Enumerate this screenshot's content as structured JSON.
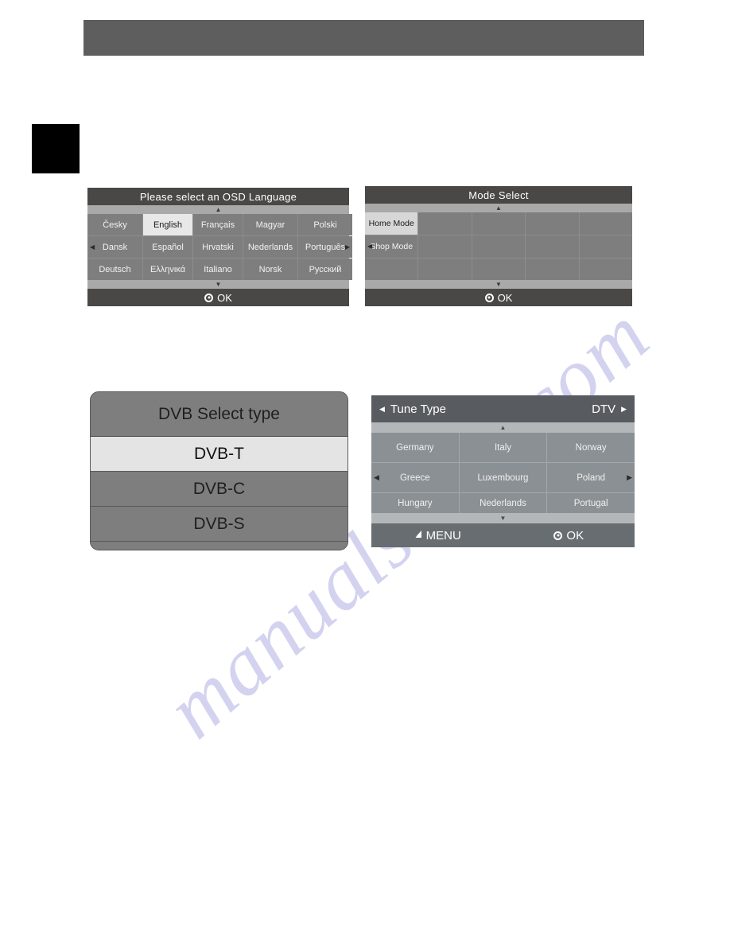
{
  "page": {
    "watermark": "manualshive.com",
    "header_bar_color": "#5e5e5e",
    "marker_color": "#000000"
  },
  "language_panel": {
    "title": "Please select an OSD Language",
    "scroll_up": "▲",
    "scroll_down": "▼",
    "left_arrow": "◀",
    "right_arrow": "▶",
    "selected": "English",
    "rows": [
      [
        {
          "label": "Česky",
          "selected": false,
          "arrow": ""
        },
        {
          "label": "English",
          "selected": true,
          "arrow": ""
        },
        {
          "label": "Français",
          "selected": false,
          "arrow": ""
        },
        {
          "label": "Magyar",
          "selected": false,
          "arrow": ""
        },
        {
          "label": "Polski",
          "selected": false,
          "arrow": ""
        }
      ],
      [
        {
          "label": "Dansk",
          "selected": false,
          "arrow": "left"
        },
        {
          "label": "Español",
          "selected": false,
          "arrow": ""
        },
        {
          "label": "Hrvatski",
          "selected": false,
          "arrow": ""
        },
        {
          "label": "Nederlands",
          "selected": false,
          "arrow": ""
        },
        {
          "label": "Português",
          "selected": false,
          "arrow": "right"
        }
      ],
      [
        {
          "label": "Deutsch",
          "selected": false,
          "arrow": ""
        },
        {
          "label": "Ελληνικά",
          "selected": false,
          "arrow": ""
        },
        {
          "label": "Italiano",
          "selected": false,
          "arrow": ""
        },
        {
          "label": "Norsk",
          "selected": false,
          "arrow": ""
        },
        {
          "label": "Русский",
          "selected": false,
          "arrow": ""
        }
      ]
    ],
    "footer": "OK",
    "footer_icon": "ok-circle-icon"
  },
  "mode_panel": {
    "title": "Mode Select",
    "scroll_up": "▲",
    "scroll_down": "▼",
    "left_arrow": "◀",
    "selected": "Home Mode",
    "rows": [
      [
        {
          "label": "Home Mode",
          "selected": true,
          "arrow": ""
        },
        {
          "label": "",
          "selected": false,
          "arrow": ""
        },
        {
          "label": "",
          "selected": false,
          "arrow": ""
        },
        {
          "label": "",
          "selected": false,
          "arrow": ""
        },
        {
          "label": "",
          "selected": false,
          "arrow": ""
        }
      ],
      [
        {
          "label": "Shop Mode",
          "selected": false,
          "arrow": "left"
        },
        {
          "label": "",
          "selected": false,
          "arrow": ""
        },
        {
          "label": "",
          "selected": false,
          "arrow": ""
        },
        {
          "label": "",
          "selected": false,
          "arrow": ""
        },
        {
          "label": "",
          "selected": false,
          "arrow": ""
        }
      ],
      [
        {
          "label": "",
          "selected": false,
          "arrow": ""
        },
        {
          "label": "",
          "selected": false,
          "arrow": ""
        },
        {
          "label": "",
          "selected": false,
          "arrow": ""
        },
        {
          "label": "",
          "selected": false,
          "arrow": ""
        },
        {
          "label": "",
          "selected": false,
          "arrow": ""
        }
      ]
    ],
    "footer": "OK",
    "footer_icon": "ok-circle-icon"
  },
  "dvb_panel": {
    "title": "DVB Select type",
    "selected": "DVB-T",
    "options": [
      {
        "label": "DVB-T",
        "selected": true
      },
      {
        "label": "DVB-C",
        "selected": false
      },
      {
        "label": "DVB-S",
        "selected": false
      }
    ]
  },
  "tune_panel": {
    "header_left_arrow": "◀",
    "header_title": "Tune Type",
    "header_value": "DTV",
    "header_right_arrow": "▶",
    "scroll_up": "▲",
    "scroll_down": "▼",
    "left_arrow": "◀",
    "right_arrow": "▶",
    "rows": [
      [
        {
          "label": "Germany",
          "arrow": ""
        },
        {
          "label": "Italy",
          "arrow": ""
        },
        {
          "label": "Norway",
          "arrow": ""
        }
      ],
      [
        {
          "label": "Greece",
          "arrow": "left"
        },
        {
          "label": "Luxembourg",
          "arrow": ""
        },
        {
          "label": "Poland",
          "arrow": "right"
        }
      ],
      [
        {
          "label": "Hungary",
          "arrow": ""
        },
        {
          "label": "Nederlands",
          "arrow": ""
        },
        {
          "label": "Portugal",
          "arrow": ""
        }
      ]
    ],
    "footer_menu": "MENU",
    "footer_menu_icon": "menu-return-arrow-icon",
    "footer_ok": "OK",
    "footer_ok_icon": "ok-circle-icon"
  }
}
